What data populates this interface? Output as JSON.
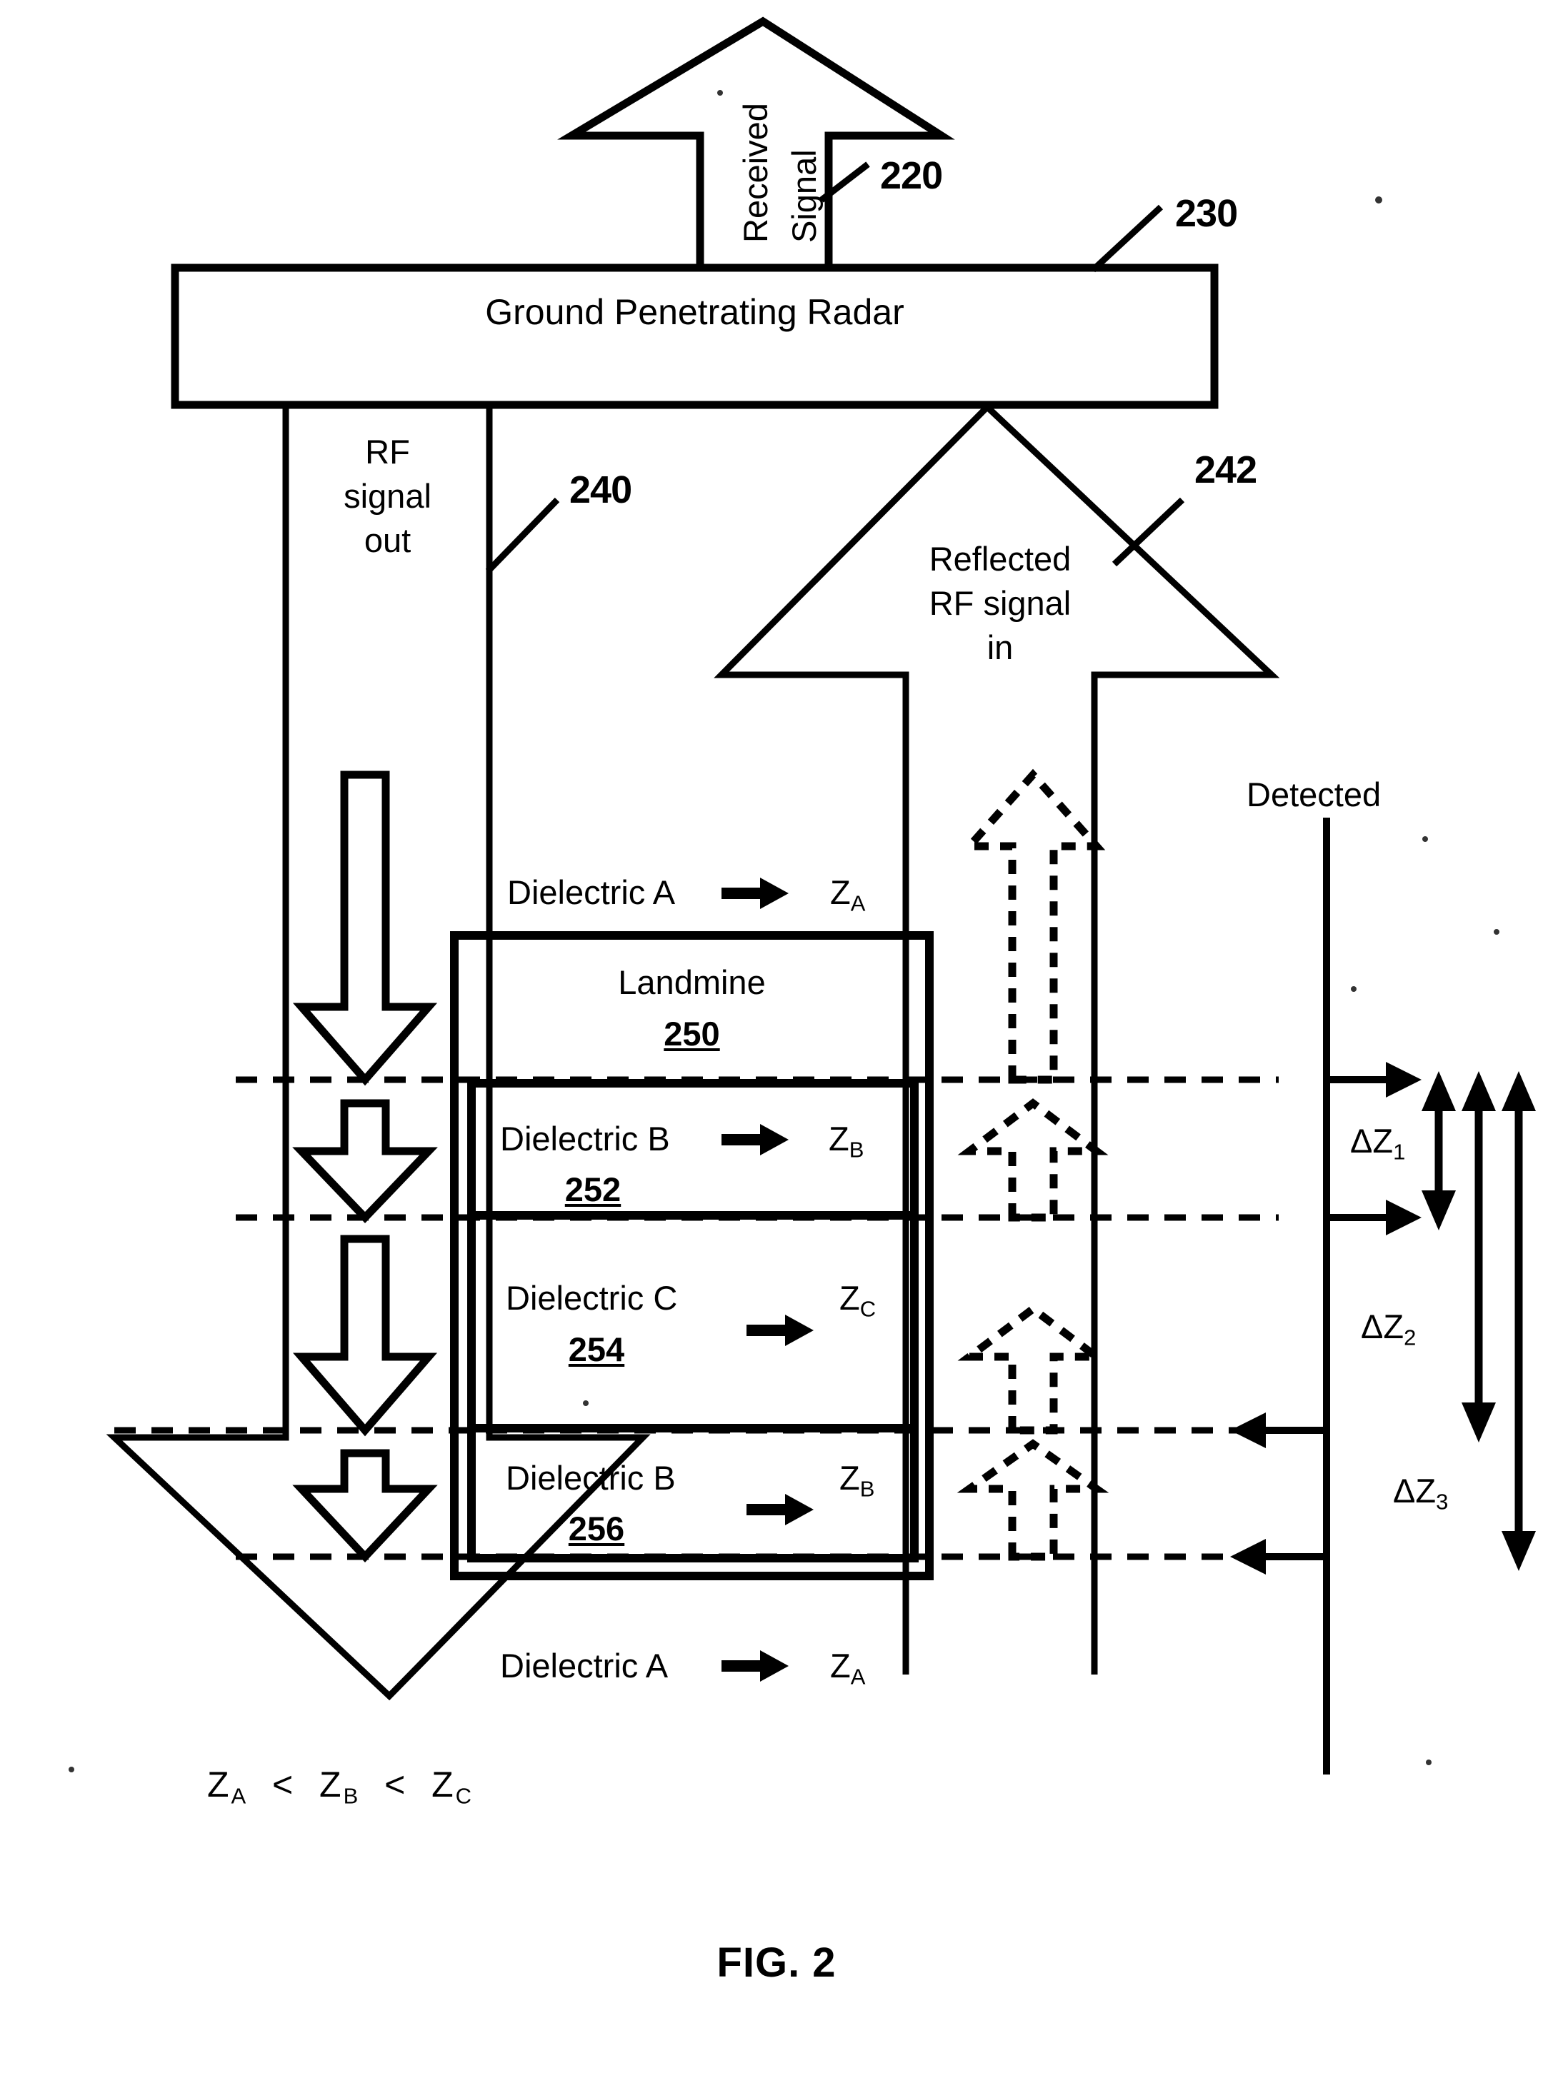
{
  "figure": {
    "caption": "FIG. 2",
    "title_number": "2"
  },
  "top_arrow": {
    "label": "Received\nSignal",
    "line1": "Received",
    "line2": "Signal",
    "ref": "220"
  },
  "radar": {
    "label": "Ground Penetrating Radar",
    "ref": "230"
  },
  "rf_out": {
    "line1": "RF",
    "line2": "signal",
    "line3": "out",
    "ref": "240"
  },
  "reflected": {
    "line1": "Reflected",
    "line2": "RF signal",
    "line3": "in",
    "ref": "242"
  },
  "layers": [
    {
      "name": "Dielectric A",
      "arrow": "→",
      "impedance": "Z",
      "impedance_sub": "A",
      "ref": ""
    },
    {
      "name": "Landmine",
      "arrow": "",
      "impedance": "",
      "impedance_sub": "",
      "ref": "250"
    },
    {
      "name": "Dielectric B",
      "arrow": "→",
      "impedance": "Z",
      "impedance_sub": "B",
      "ref": "252"
    },
    {
      "name": "Dielectric C",
      "arrow": "→",
      "impedance": "Z",
      "impedance_sub": "C",
      "ref": "254"
    },
    {
      "name": "Dielectric B",
      "arrow": "→",
      "impedance": "Z",
      "impedance_sub": "B",
      "ref": "256"
    },
    {
      "name": "Dielectric A",
      "arrow": "→",
      "impedance": "Z",
      "impedance_sub": "A",
      "ref": ""
    }
  ],
  "detected": {
    "label": "Detected",
    "deltas": [
      {
        "symbol": "ΔZ",
        "sub": "1"
      },
      {
        "symbol": "ΔZ",
        "sub": "2"
      },
      {
        "symbol": "ΔZ",
        "sub": "3"
      }
    ]
  },
  "inequality": {
    "z1": "Z",
    "z1s": "A",
    "op1": "<",
    "z2": "Z",
    "z2s": "B",
    "op2": "<",
    "z3": "Z",
    "z3s": "C"
  },
  "colors": {
    "ink": "#000000",
    "paper": "#ffffff"
  }
}
